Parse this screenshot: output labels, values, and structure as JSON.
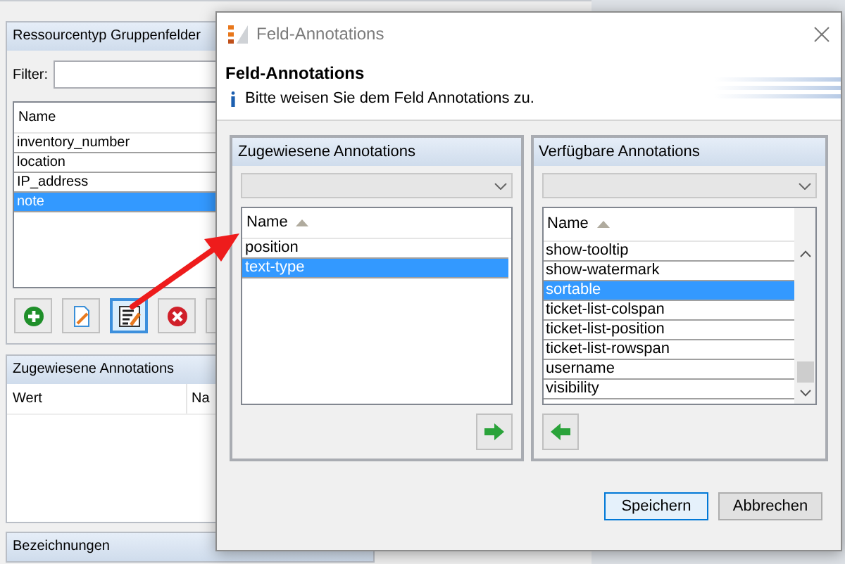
{
  "background_window": {
    "group_fields": {
      "title": "Ressourcentyp Gruppenfelder",
      "filter_label": "Filter:",
      "column": "Name",
      "rows": [
        {
          "name": "inventory_number",
          "selected": false
        },
        {
          "name": "location",
          "selected": false
        },
        {
          "name": "IP_address",
          "selected": false
        },
        {
          "name": "note",
          "selected": true
        }
      ],
      "toolbar": [
        {
          "kind": "add",
          "selected": false
        },
        {
          "kind": "edit",
          "selected": false
        },
        {
          "kind": "annotate",
          "selected": true
        },
        {
          "kind": "delete",
          "selected": false
        },
        {
          "kind": "partial",
          "selected": false
        }
      ]
    },
    "assigned": {
      "title": "Zugewiesene Annotations",
      "columns": [
        "Wert",
        "Na"
      ]
    },
    "labels": {
      "title": "Bezeichnungen"
    }
  },
  "dialog": {
    "title": "Feld-Annotations",
    "heading": "Feld-Annotations",
    "info": "Bitte weisen Sie dem Feld Annotations zu.",
    "assigned": {
      "title": "Zugewiesene Annotations",
      "column": "Name",
      "rows": [
        {
          "name": "position",
          "selected": false
        },
        {
          "name": "text-type",
          "selected": true
        }
      ]
    },
    "available": {
      "title": "Verfügbare Annotations",
      "column": "Name",
      "rows": [
        {
          "name": "show-tooltip",
          "selected": false
        },
        {
          "name": "show-watermark",
          "selected": false
        },
        {
          "name": "sortable",
          "selected": true
        },
        {
          "name": "ticket-list-colspan",
          "selected": false
        },
        {
          "name": "ticket-list-position",
          "selected": false
        },
        {
          "name": "ticket-list-rowspan",
          "selected": false
        },
        {
          "name": "username",
          "selected": false
        },
        {
          "name": "visibility",
          "selected": false
        }
      ]
    },
    "buttons": [
      "Speichern",
      "Abbrechen"
    ]
  }
}
